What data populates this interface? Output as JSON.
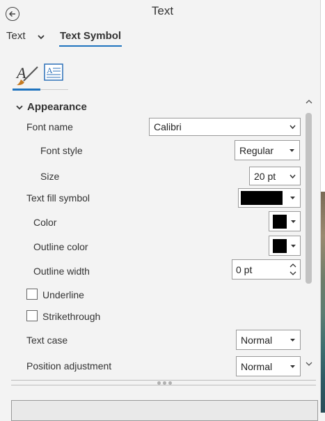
{
  "header": {
    "title": "Text",
    "tabs": [
      {
        "label": "Text"
      },
      {
        "label": "Text Symbol"
      }
    ]
  },
  "subtabs": [
    {
      "icon": "text-brush-icon"
    },
    {
      "icon": "text-frame-icon"
    }
  ],
  "section": {
    "title": "Appearance"
  },
  "properties": {
    "font_name": {
      "label": "Font name",
      "value": "Calibri"
    },
    "font_style": {
      "label": "Font style",
      "value": "Regular"
    },
    "size": {
      "label": "Size",
      "value": "20 pt"
    },
    "text_fill_symbol": {
      "label": "Text fill symbol",
      "swatch_color": "#000000"
    },
    "color": {
      "label": "Color",
      "swatch_color": "#000000"
    },
    "outline_color": {
      "label": "Outline color",
      "swatch_color": "#000000"
    },
    "outline_width": {
      "label": "Outline width",
      "value": "0 pt"
    },
    "underline": {
      "label": "Underline",
      "checked": false
    },
    "strikethrough": {
      "label": "Strikethrough",
      "checked": false
    },
    "text_case": {
      "label": "Text case",
      "value": "Normal"
    },
    "position_adjustment": {
      "label": "Position adjustment",
      "value": "Normal"
    }
  },
  "colors": {
    "accent": "#1e73be",
    "background": "#f3f3f3"
  }
}
